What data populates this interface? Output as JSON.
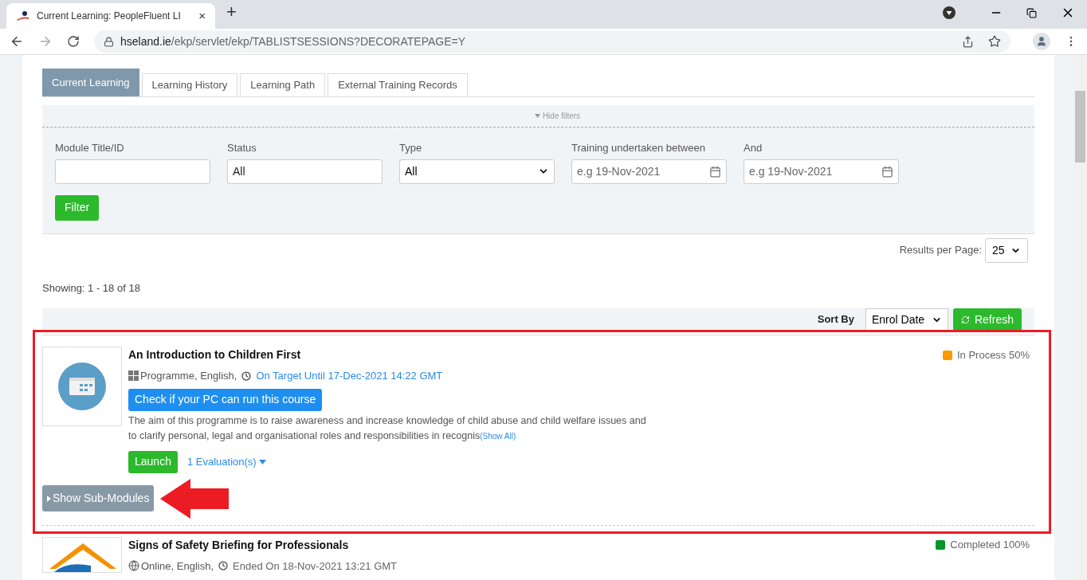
{
  "browser": {
    "tab_title": "Current Learning: PeopleFluent LI",
    "tab_close": "×",
    "new_tab": "+",
    "url_host": "hseland.ie",
    "url_path": "/ekp/servlet/ekp/TABLISTSESSIONS?DECORATEPAGE=Y"
  },
  "tabs": [
    {
      "label": "Current Learning",
      "selected": true
    },
    {
      "label": "Learning History",
      "selected": false
    },
    {
      "label": "Learning Path",
      "selected": false
    },
    {
      "label": "External Training Records",
      "selected": false
    }
  ],
  "filters": {
    "toggle": "Hide filters",
    "fields": [
      {
        "kind": "text",
        "label": "Module Title/ID"
      },
      {
        "kind": "text",
        "label": "Status",
        "value": "All"
      },
      {
        "kind": "select",
        "label": "Type",
        "value": "All"
      },
      {
        "kind": "date",
        "label": "Training undertaken between",
        "placeholder": "e.g 19-Nov-2021"
      },
      {
        "kind": "date",
        "label": "And",
        "placeholder": "e.g 19-Nov-2021"
      }
    ],
    "button": "Filter"
  },
  "results_per_page": {
    "label": "Results per Page:",
    "value": "25"
  },
  "showing": "Showing: 1 - 18 of 18",
  "sort": {
    "label": "Sort By",
    "value": "Enrol Date",
    "refresh": "Refresh"
  },
  "items": [
    {
      "kind": "programme",
      "title": "An Introduction to Children First",
      "meta": "Programme, English,",
      "date": "On Target Until 17-Dec-2021 14:22 GMT",
      "date_highlight": true,
      "status": "In Process 50%",
      "color": "#ff9900",
      "check_button": "Check if your PC can run this course",
      "description": "The aim of this programme is to raise awareness and increase knowledge of child abuse and child welfare issues and to clarify personal, legal and organisational roles and responsibilities in recognis",
      "show_all": "(Show All)",
      "launch": "Launch",
      "evaluations": "1 Evaluation(s)",
      "sub_modules": "Show Sub-Modules",
      "highlighted": true
    },
    {
      "kind": "online",
      "title": "Signs of Safety Briefing for Professionals",
      "meta": "Online, English,",
      "date": "Ended On 18-Nov-2021 13:21 GMT",
      "date_highlight": false,
      "status": "Completed 100%",
      "color": "#00952e",
      "highlighted": false
    }
  ]
}
